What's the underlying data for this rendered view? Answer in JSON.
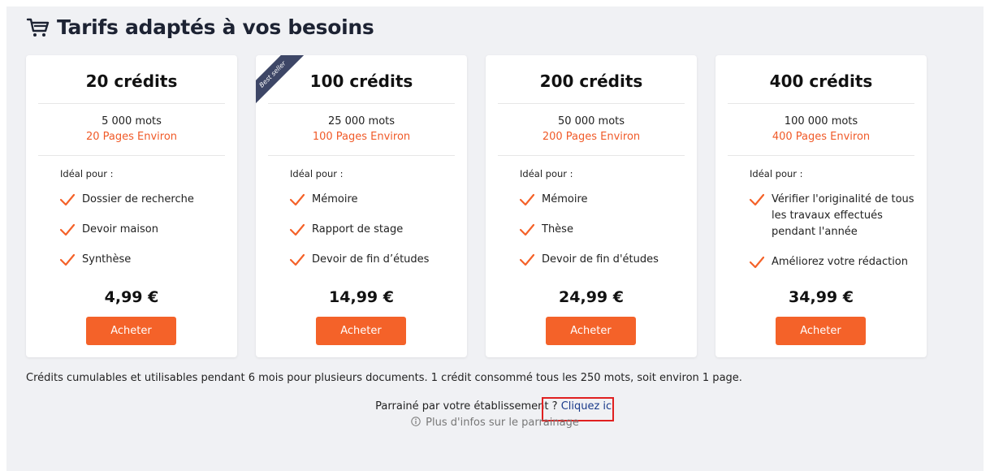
{
  "header": {
    "title": "Tarifs adaptés à vos besoins",
    "icon": "cart-icon"
  },
  "colors": {
    "accent": "#f46229",
    "ribbon": "#3d4666",
    "link": "#1a3a8a",
    "highlight": "#e02020"
  },
  "cards": [
    {
      "title": "20 crédits",
      "words": "5 000 mots",
      "pages": "20 Pages Environ",
      "ideal_label": "Idéal pour :",
      "features": [
        "Dossier de recherche",
        "Devoir maison",
        "Synthèse"
      ],
      "price": "4,99 €",
      "button": "Acheter",
      "badge": ""
    },
    {
      "title": "100 crédits",
      "words": "25 000 mots",
      "pages": "100 Pages Environ",
      "ideal_label": "Idéal pour :",
      "features": [
        "Mémoire",
        "Rapport de stage",
        "Devoir de fin d’études"
      ],
      "price": "14,99 €",
      "button": "Acheter",
      "badge": "Best seller"
    },
    {
      "title": "200 crédits",
      "words": "50 000 mots",
      "pages": "200 Pages Environ",
      "ideal_label": "Idéal pour :",
      "features": [
        "Mémoire",
        "Thèse",
        "Devoir de fin d'études"
      ],
      "price": "24,99 €",
      "button": "Acheter",
      "badge": ""
    },
    {
      "title": "400 crédits",
      "words": "100 000 mots",
      "pages": "400 Pages Environ",
      "ideal_label": "Idéal pour :",
      "features": [
        "Vérifier l'originalité de tous les travaux effectués pendant l'année",
        "Améliorez votre rédaction"
      ],
      "price": "34,99 €",
      "button": "Acheter",
      "badge": ""
    }
  ],
  "footnote": "Crédits cumulables et utilisables pendant 6 mois pour plusieurs documents. 1 crédit consommé tous les 250 mots, soit environ 1 page.",
  "referral": {
    "question": "Parrainé par votre établissement ? ",
    "link": "Cliquez ici",
    "more_info": "Plus d'infos sur le parrainage"
  }
}
